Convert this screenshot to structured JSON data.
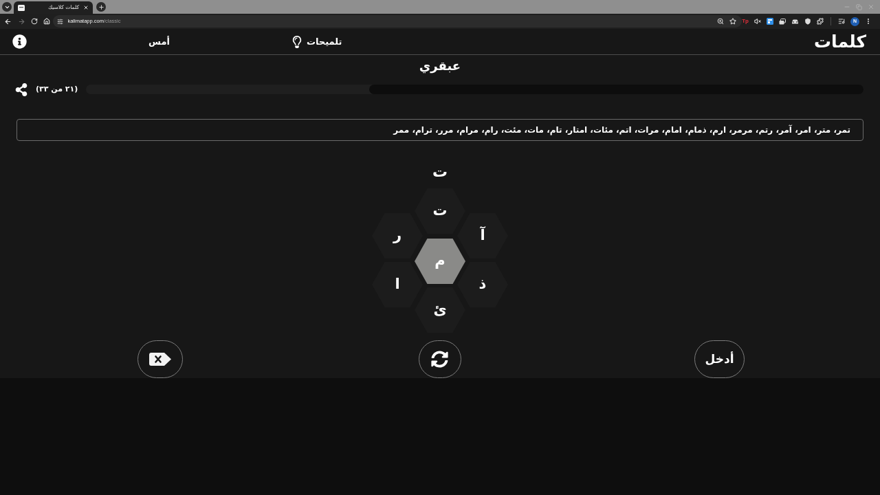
{
  "browser": {
    "tab": {
      "title": "كلمات كلاسيك"
    },
    "forward_disabled": true,
    "url": {
      "host": "kalimatapp.com",
      "path": "/classic"
    },
    "extension_label": "Tp",
    "profile": "N"
  },
  "header": {
    "logo": "كلمات",
    "nav": [
      {
        "kind": "hints",
        "label": "تلميحات"
      },
      {
        "kind": "link",
        "label": "أمس"
      },
      {
        "kind": "info"
      }
    ]
  },
  "rank": "عبقري",
  "progress": {
    "label": "(٢١ من ٣٣)",
    "level": 0.636
  },
  "found_words": "تمر، متر، امر، آمر، رتم، مرمر، ارم، ذمام، امام، مرات، اتم، مئات، امتار، تام، مات، مئت، رام، مرام، مرر، ترام، ممر",
  "current_word": "ت",
  "hive": {
    "center": "م",
    "outer": [
      "ت",
      "آ",
      "ذ",
      "ئ",
      "ا",
      "ر"
    ]
  },
  "actions": [
    {
      "kind": "enter",
      "label": "أدخل"
    },
    {
      "kind": "shuffle"
    },
    {
      "kind": "delete"
    }
  ]
}
